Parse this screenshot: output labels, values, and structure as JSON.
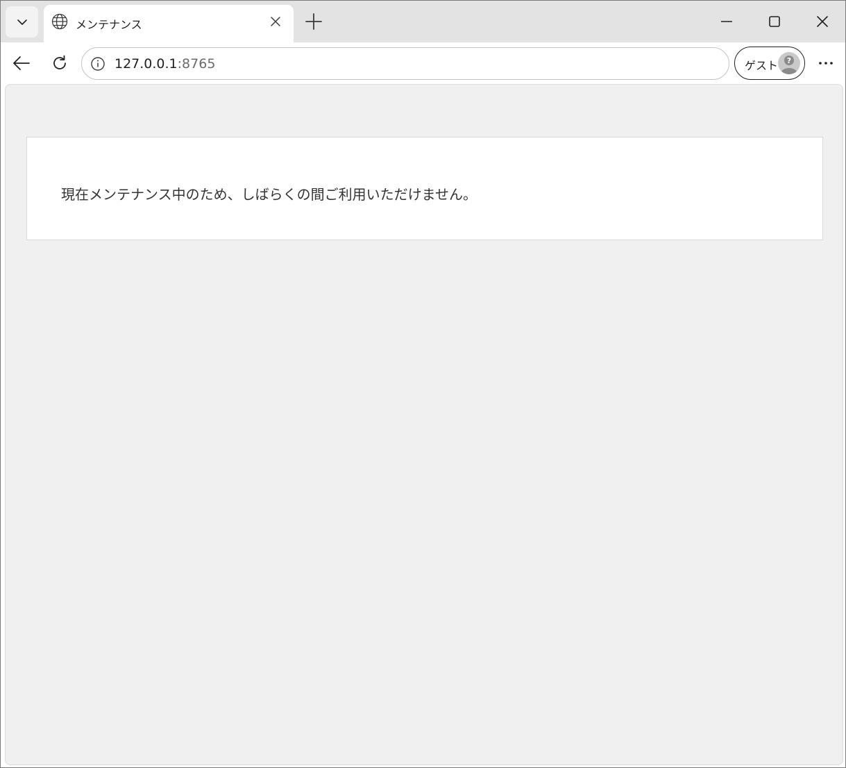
{
  "tab": {
    "title": "メンテナンス"
  },
  "address_bar": {
    "host": "127.0.0.1",
    "port": ":8765"
  },
  "profile": {
    "label": "ゲスト"
  },
  "content": {
    "message": "現在メンテナンス中のため、しばらくの間ご利用いただけません。"
  },
  "icons": {
    "tab_search": "chevron-down-icon",
    "favicon": "globe-icon",
    "tab_close": "close-icon",
    "new_tab": "plus-icon",
    "minimize": "minimize-icon",
    "maximize": "maximize-icon",
    "window_close": "close-icon",
    "back": "arrow-left-icon",
    "reload": "reload-icon",
    "site_info": "info-icon",
    "avatar": "guest-avatar-icon",
    "more": "more-horizontal-icon"
  },
  "colors": {
    "tabstrip_bg": "#e3e3e3",
    "page_bg": "#f0f0f0",
    "card_bg": "#ffffff",
    "text": "#333333"
  }
}
